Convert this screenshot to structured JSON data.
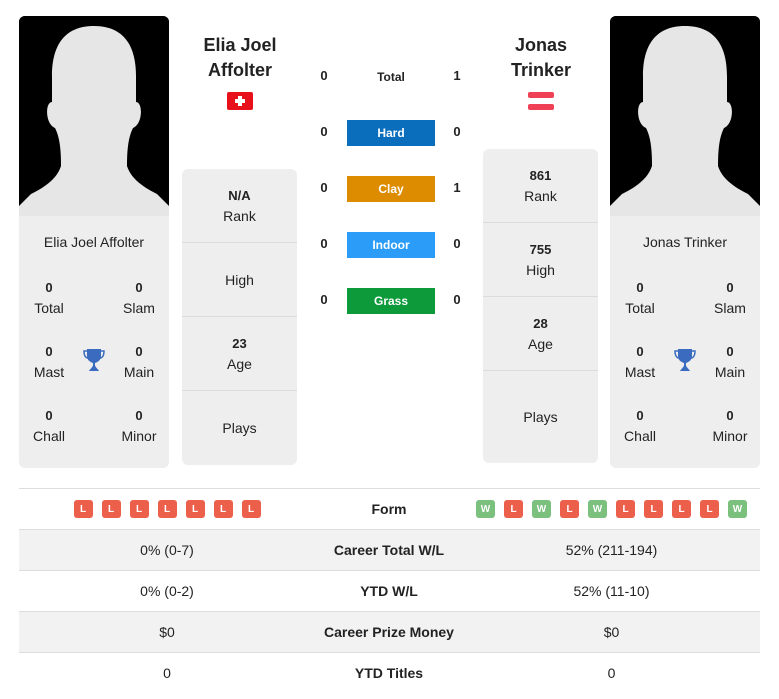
{
  "colors": {
    "hard": "#0a6ebd",
    "clay": "#dd8c00",
    "indoor": "#2b9cf8",
    "grass": "#0c9a3a",
    "loss": "#ec5f4b",
    "win": "#7cc07d",
    "trophy": "#3a6bbf"
  },
  "player1": {
    "name_line1": "Elia Joel",
    "name_line2": "Affolter",
    "card_name": "Elia Joel Affolter",
    "flag": "switzerland-flag",
    "titles": {
      "total": "0",
      "total_label": "Total",
      "slam": "0",
      "slam_label": "Slam",
      "mast": "0",
      "mast_label": "Mast",
      "main": "0",
      "main_label": "Main",
      "chall": "0",
      "chall_label": "Chall",
      "minor": "0",
      "minor_label": "Minor"
    },
    "info": {
      "rank": "N/A",
      "rank_label": "Rank",
      "high": "",
      "high_label": "High",
      "age": "23",
      "age_label": "Age",
      "plays": "",
      "plays_label": "Plays"
    },
    "form": [
      "L",
      "L",
      "L",
      "L",
      "L",
      "L",
      "L"
    ],
    "career_wl": "0% (0-7)",
    "ytd_wl": "0% (0-2)",
    "prize": "$0",
    "ytd_titles": "0"
  },
  "player2": {
    "name_line1": "Jonas",
    "name_line2": "Trinker",
    "card_name": "Jonas Trinker",
    "flag": "austria-flag",
    "titles": {
      "total": "0",
      "total_label": "Total",
      "slam": "0",
      "slam_label": "Slam",
      "mast": "0",
      "mast_label": "Mast",
      "main": "0",
      "main_label": "Main",
      "chall": "0",
      "chall_label": "Chall",
      "minor": "0",
      "minor_label": "Minor"
    },
    "info": {
      "rank": "861",
      "rank_label": "Rank",
      "high": "755",
      "high_label": "High",
      "age": "28",
      "age_label": "Age",
      "plays": "",
      "plays_label": "Plays"
    },
    "form": [
      "W",
      "L",
      "W",
      "L",
      "W",
      "L",
      "L",
      "L",
      "L",
      "W"
    ],
    "career_wl": "52% (211-194)",
    "ytd_wl": "52% (11-10)",
    "prize": "$0",
    "ytd_titles": "0"
  },
  "h2h": [
    {
      "label": "Total",
      "p1": "0",
      "p2": "1",
      "surface": "total"
    },
    {
      "label": "Hard",
      "p1": "0",
      "p2": "0",
      "surface": "hard"
    },
    {
      "label": "Clay",
      "p1": "0",
      "p2": "1",
      "surface": "clay"
    },
    {
      "label": "Indoor",
      "p1": "0",
      "p2": "0",
      "surface": "indoor"
    },
    {
      "label": "Grass",
      "p1": "0",
      "p2": "0",
      "surface": "grass"
    }
  ],
  "table": {
    "form_label": "Form",
    "career_label": "Career Total W/L",
    "ytd_wl_label": "YTD W/L",
    "prize_label": "Career Prize Money",
    "ytd_titles_label": "YTD Titles"
  }
}
